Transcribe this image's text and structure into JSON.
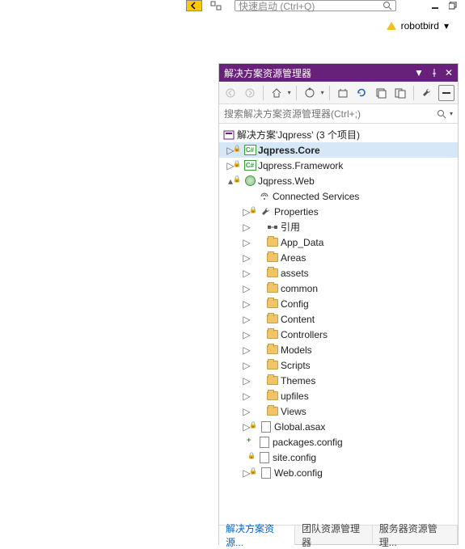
{
  "top": {
    "quick_launch_placeholder": "快速启动 (Ctrl+Q)",
    "user_name": "robotbird"
  },
  "panel": {
    "title": "解决方案资源管理器",
    "search_placeholder": "搜索解决方案资源管理器(Ctrl+;)"
  },
  "tree": {
    "solution": "解决方案'Jqpress' (3 个项目)",
    "proj_core": "Jqpress.Core",
    "proj_framework": "Jqpress.Framework",
    "proj_web": "Jqpress.Web",
    "connected_services": "Connected Services",
    "properties": "Properties",
    "references": "引用",
    "folders": {
      "app_data": "App_Data",
      "areas": "Areas",
      "assets": "assets",
      "common": "common",
      "config": "Config",
      "content": "Content",
      "controllers": "Controllers",
      "models": "Models",
      "scripts": "Scripts",
      "themes": "Themes",
      "upfiles": "upfiles",
      "views": "Views"
    },
    "files": {
      "global_asax": "Global.asax",
      "packages_config": "packages.config",
      "site_config": "site.config",
      "web_config": "Web.config"
    }
  },
  "tabs": {
    "solution_explorer": "解决方案资源...",
    "team_explorer": "团队资源管理器",
    "server_explorer": "服务器资源管理..."
  }
}
